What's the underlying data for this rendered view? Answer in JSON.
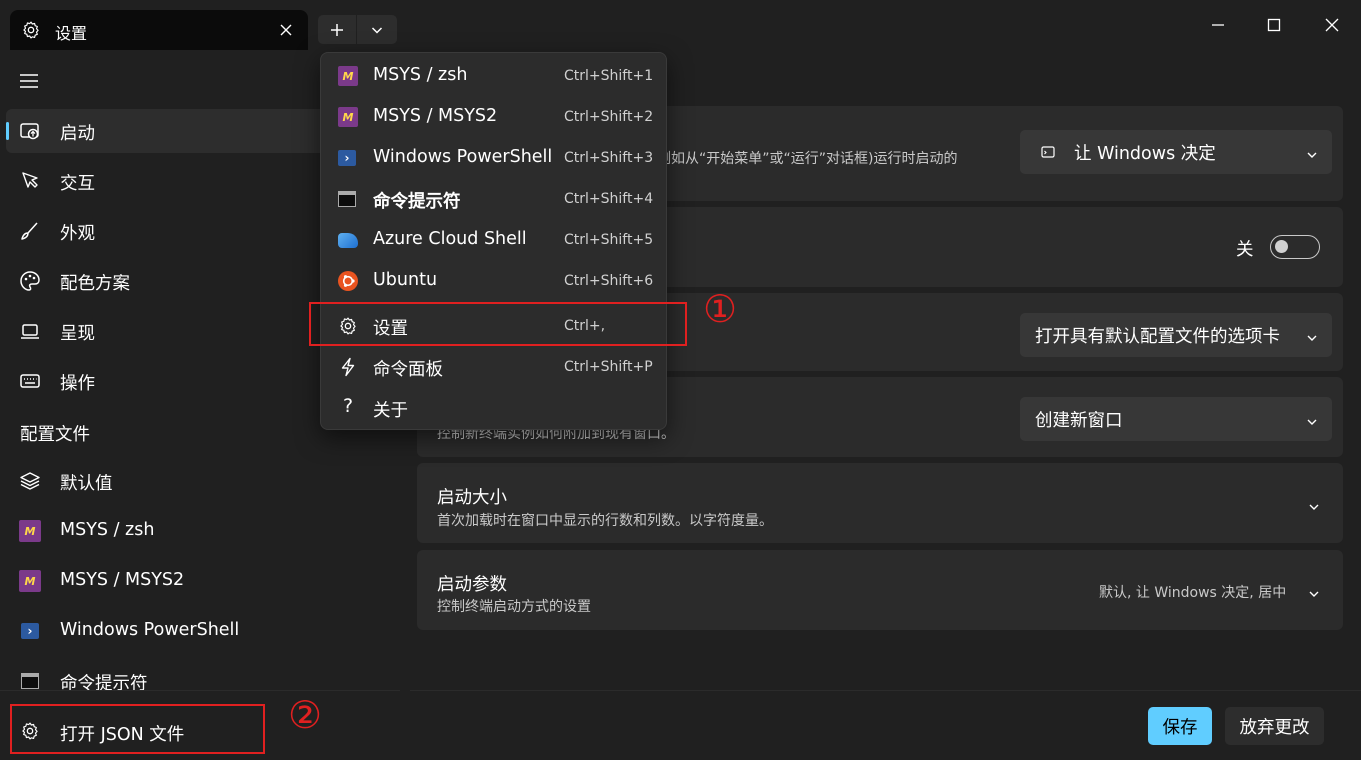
{
  "titlebar": {
    "tab_title": "设置",
    "new_tab_symbol": "+"
  },
  "sidebar": {
    "items": [
      {
        "label": "启动",
        "icon": "launch-icon",
        "selected": true
      },
      {
        "label": "交互",
        "icon": "interaction-icon"
      },
      {
        "label": "外观",
        "icon": "brush-icon"
      },
      {
        "label": "配色方案",
        "icon": "palette-icon"
      },
      {
        "label": "呈现",
        "icon": "laptop-icon"
      },
      {
        "label": "操作",
        "icon": "keyboard-icon"
      }
    ],
    "section_profiles": "配置文件",
    "profiles": [
      {
        "label": "默认值",
        "icon": "layers-icon"
      },
      {
        "label": "MSYS / zsh",
        "icon": "msys-icon"
      },
      {
        "label": "MSYS / MSYS2",
        "icon": "msys-icon"
      },
      {
        "label": "Windows PowerShell",
        "icon": "powershell-icon"
      },
      {
        "label": "命令提示符",
        "icon": "cmd-icon"
      }
    ],
    "open_json": "打开 JSON 文件"
  },
  "annotations": {
    "one": "①",
    "two": "②"
  },
  "main": {
    "card1": {
      "desc": "例如从“开始菜单”或“运行”对话框)运行时启动的",
      "value": "让 Windows 决定"
    },
    "card2": {
      "toggle_label": "关",
      "toggle_on": false
    },
    "card3": {
      "value": "打开具有默认配置文件的选项卡"
    },
    "card4": {
      "desc": "控制新终端实例如何附加到现有窗口。",
      "value": "创建新窗口"
    },
    "card5": {
      "title": "启动大小",
      "desc": "首次加载时在窗口中显示的行数和列数。以字符度量。"
    },
    "card6": {
      "title": "启动参数",
      "desc": "控制终端启动方式的设置",
      "value": "默认, 让 Windows 决定, 居中"
    }
  },
  "footer": {
    "save": "保存",
    "discard": "放弃更改"
  },
  "menu": {
    "items": [
      {
        "label": "MSYS / zsh",
        "accel": "Ctrl+Shift+1",
        "icon": "msys-icon"
      },
      {
        "label": "MSYS / MSYS2",
        "accel": "Ctrl+Shift+2",
        "icon": "msys-icon"
      },
      {
        "label": "Windows PowerShell",
        "accel": "Ctrl+Shift+3",
        "icon": "powershell-icon"
      },
      {
        "label": "命令提示符",
        "accel": "Ctrl+Shift+4",
        "icon": "cmd-icon",
        "bold": true
      },
      {
        "label": "Azure Cloud Shell",
        "accel": "Ctrl+Shift+5",
        "icon": "azure-icon"
      },
      {
        "label": "Ubuntu",
        "accel": "Ctrl+Shift+6",
        "icon": "ubuntu-icon"
      },
      {
        "label": "设置",
        "accel": "Ctrl+,",
        "icon": "gear-icon"
      },
      {
        "label": "命令面板",
        "accel": "Ctrl+Shift+P",
        "icon": "lightning-icon"
      },
      {
        "label": "关于",
        "accel": "",
        "icon": "question-icon"
      }
    ]
  },
  "colors": {
    "accent": "#60cdff",
    "annotation": "#e02020",
    "background": "#202020",
    "card": "#2b2b2b"
  }
}
